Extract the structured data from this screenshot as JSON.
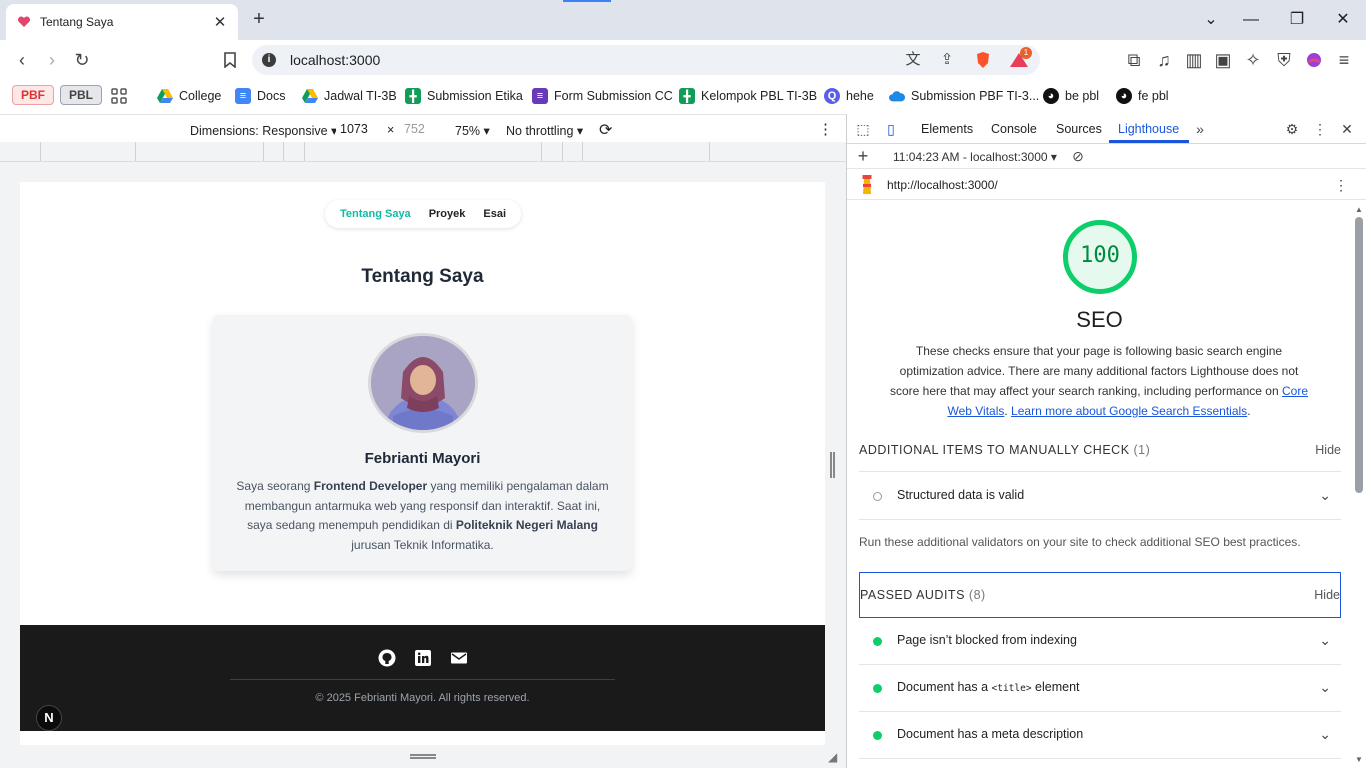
{
  "browser": {
    "tab_title": "Tentang Saya",
    "url": "localhost:3000",
    "bookmarks": [
      {
        "label": "College",
        "icon": "drive-icon"
      },
      {
        "label": "Docs",
        "icon": "docs-icon"
      },
      {
        "label": "Jadwal TI-3B",
        "icon": "drive-icon"
      },
      {
        "label": "Submission Etika",
        "icon": "sheets-icon"
      },
      {
        "label": "Form Submission CC",
        "icon": "forms-icon"
      },
      {
        "label": "Kelompok PBL TI-3B",
        "icon": "sheets-icon"
      },
      {
        "label": "hehe",
        "icon": "q-icon"
      },
      {
        "label": "Submission PBF TI-3...",
        "icon": "cloud-icon"
      },
      {
        "label": "be pbl",
        "icon": "github-icon"
      },
      {
        "label": "fe pbl",
        "icon": "github-icon"
      }
    ],
    "chips": {
      "pbf": "PBF",
      "pbl": "PBL"
    },
    "brave_badge": "1"
  },
  "device_toolbar": {
    "dimensions_label": "Dimensions: Responsive",
    "width": "1073",
    "times": "×",
    "height_placeholder": "752",
    "zoom": "75%",
    "throttling": "No throttling"
  },
  "page": {
    "nav": {
      "about": "Tentang Saya",
      "projects": "Proyek",
      "essays": "Esai"
    },
    "title": "Tentang Saya",
    "name": "Febrianti Mayori",
    "bio": {
      "p1": "Saya seorang ",
      "b1": "Frontend Developer",
      "p2": " yang memiliki pengalaman dalam membangun antarmuka web yang responsif dan interaktif. Saat ini, saya sedang menempuh pendidikan di ",
      "b2": "Politeknik Negeri Malang",
      "p3": " jurusan Teknik Informatika."
    },
    "footer_copy": "© 2025 Febrianti Mayori. All rights reserved.",
    "next_badge": "N"
  },
  "devtools": {
    "tabs": {
      "elements": "Elements",
      "console": "Console",
      "sources": "Sources",
      "lighthouse": "Lighthouse"
    },
    "report_time": "11:04:23 AM - localhost:3000",
    "report_url": "http://localhost:3000/",
    "score": "100",
    "category": "SEO",
    "desc": {
      "text": "These checks ensure that your page is following basic search engine optimization advice. There are many additional factors Lighthouse does not score here that may affect your search ranking, including performance on ",
      "link1": "Core Web Vitals",
      "sep": ". ",
      "link2": "Learn more about Google Search Essentials",
      "end": "."
    },
    "manual": {
      "title": "ADDITIONAL ITEMS TO MANUALLY CHECK",
      "count": "(1)",
      "hide": "Hide",
      "item": "Structured data is valid",
      "note": "Run these additional validators on your site to check additional SEO best practices."
    },
    "passed": {
      "title": "PASSED AUDITS",
      "count": "(8)",
      "hide": "Hide",
      "items": [
        {
          "text": "Page isn’t blocked from indexing"
        },
        {
          "pre": "Document has a ",
          "code": "<title>",
          "post": " element"
        },
        {
          "text": "Document has a meta description"
        }
      ]
    },
    "colors": {
      "pass": "#0cce6b",
      "accent": "#1a56db"
    }
  }
}
